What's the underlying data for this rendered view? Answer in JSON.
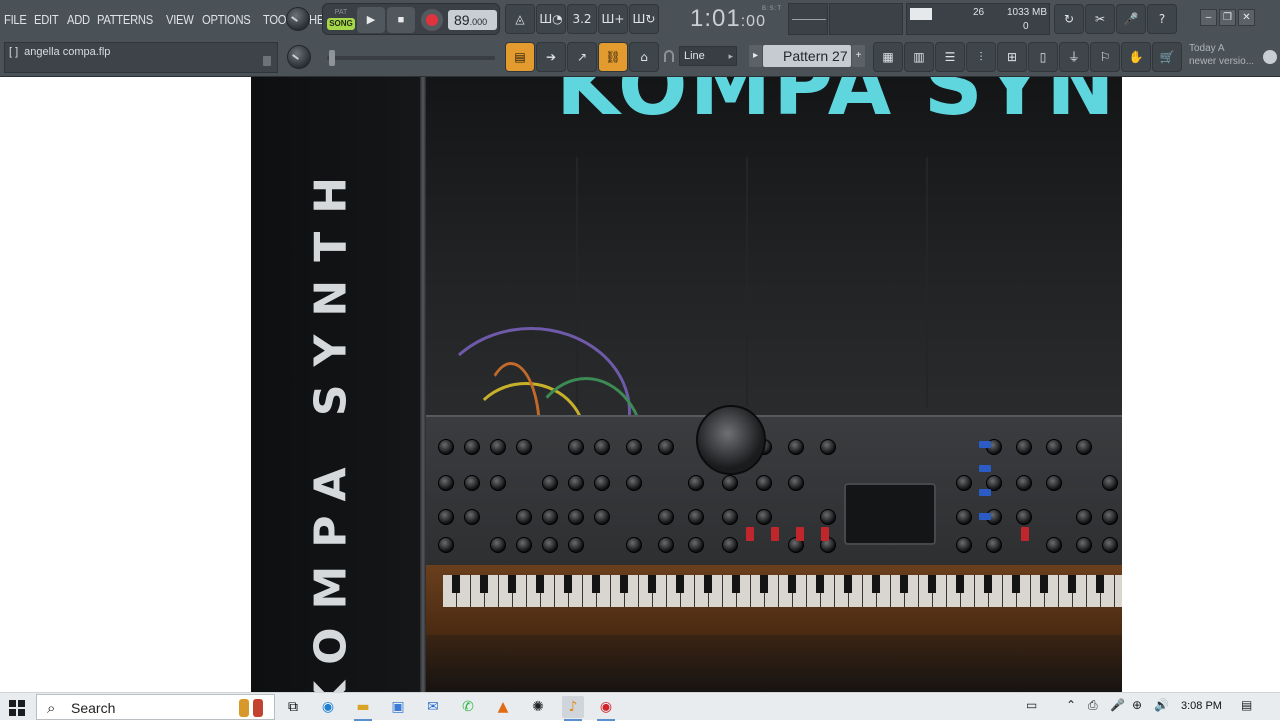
{
  "menu": [
    "FILE",
    "EDIT",
    "ADD",
    "PATTERNS",
    "VIEW",
    "OPTIONS",
    "TOOLS",
    "HELP"
  ],
  "transport": {
    "pat_label": "PAT",
    "song_label": "SONG",
    "play_label": "▶",
    "stop_label": "■",
    "tempo": "89",
    "tempo_frac": ".000"
  },
  "time": {
    "main": "1:01",
    "sub": ":00",
    "bst": "B:S:T"
  },
  "cpu": {
    "voices": "26",
    "memory": "1033 MB",
    "polyphony": "0"
  },
  "toolbar_icons": {
    "metronome": "◬",
    "wait": "Ш◔",
    "countdown": "3.2",
    "blend": "Ш+",
    "loop_rec": "Ш↻",
    "reset": "↻",
    "cut": "✂",
    "mic": "🎤",
    "help": "?"
  },
  "window_controls": {
    "minimize": "–",
    "restore": "❐",
    "close": "✕"
  },
  "file": {
    "bracket": "[ ]",
    "name": "angella compa.flp"
  },
  "row2_icons": {
    "piano": "▤",
    "arrow": "➔",
    "brush": "↗",
    "link": "⛓",
    "stamp": "⌂",
    "grid": "▦",
    "bars": "▥",
    "list": "☰",
    "mixer": "⫶",
    "tree": "⊞",
    "page": "▯",
    "plug": "⏚",
    "touch": "⚐",
    "hand": "✋",
    "cart": "🛒"
  },
  "line_mode": "Line",
  "pattern": {
    "label": "Pattern 27",
    "prev": "▸",
    "add": "+"
  },
  "hint": {
    "line1": "Today  A",
    "line2": "newer versio..."
  },
  "cover": {
    "vertical_title": "KOMPA SYNTH",
    "top_title": "KOMPA SYNTH",
    "title_color": "#5fd6dd"
  },
  "taskbar": {
    "search_placeholder": "Search",
    "clock": "3:08 PM",
    "apps": [
      "task-view",
      "edge",
      "file-explorer",
      "store",
      "mail",
      "whatsapp",
      "vlc",
      "chatgpt",
      "fl-studio",
      "recorder"
    ]
  }
}
